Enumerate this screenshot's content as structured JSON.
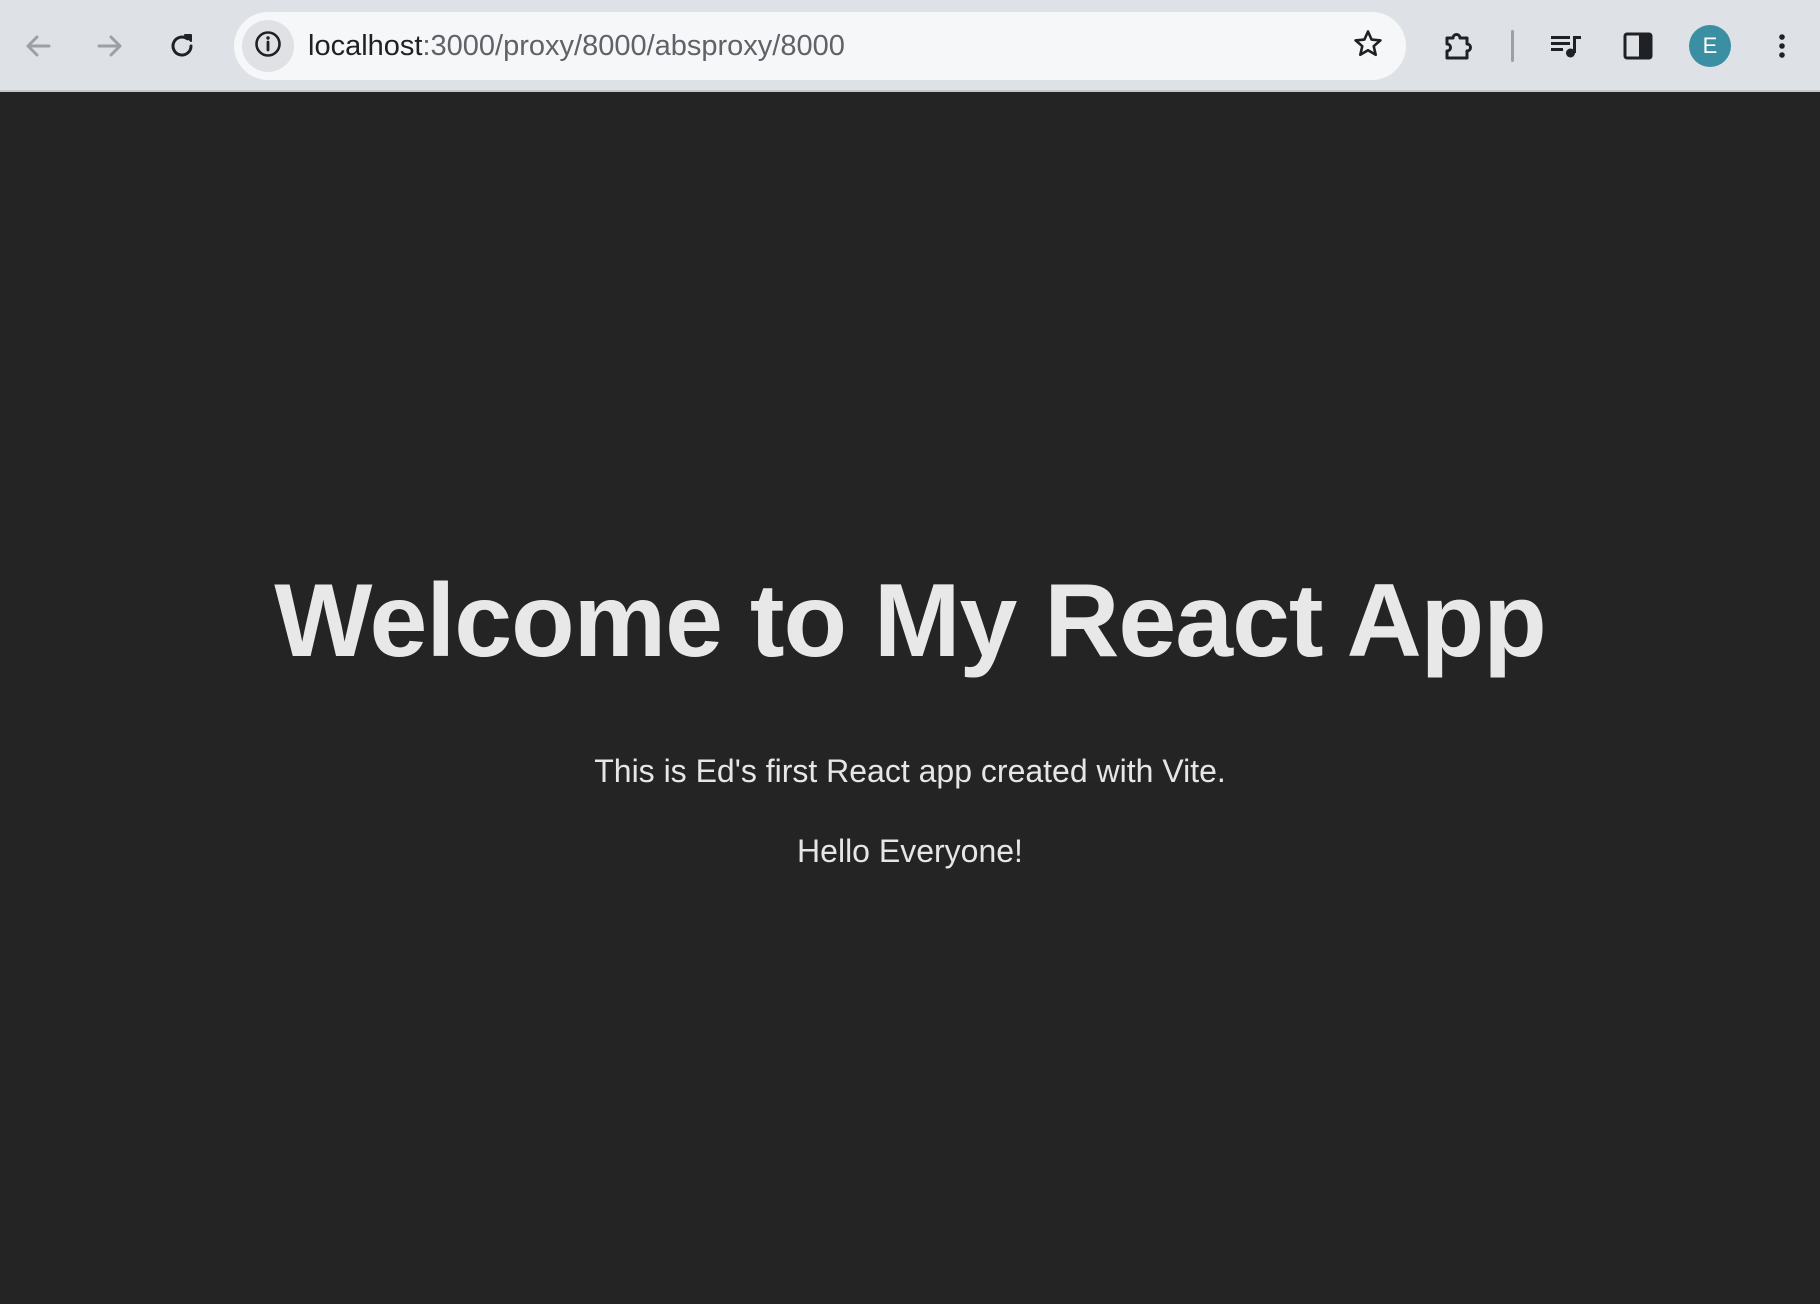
{
  "browser": {
    "url_host": "localhost",
    "url_path": ":3000/proxy/8000/absproxy/8000",
    "profile_initial": "E",
    "icons": {
      "back": "arrow-left-icon",
      "forward": "arrow-right-icon",
      "reload": "reload-icon",
      "site_info": "info-icon",
      "bookmark": "star-icon",
      "extensions": "puzzle-icon",
      "media": "media-queue-icon",
      "side_panel": "side-panel-icon",
      "menu": "kebab-menu-icon"
    }
  },
  "page": {
    "heading": "Welcome to My React App",
    "description": "This is Ed's first React app created with Vite.",
    "greeting": "Hello Everyone!"
  },
  "colors": {
    "page_background": "#242424",
    "text": "#e8e8e8",
    "toolbar": "#dee1e6",
    "avatar": "#3a8fa3"
  }
}
